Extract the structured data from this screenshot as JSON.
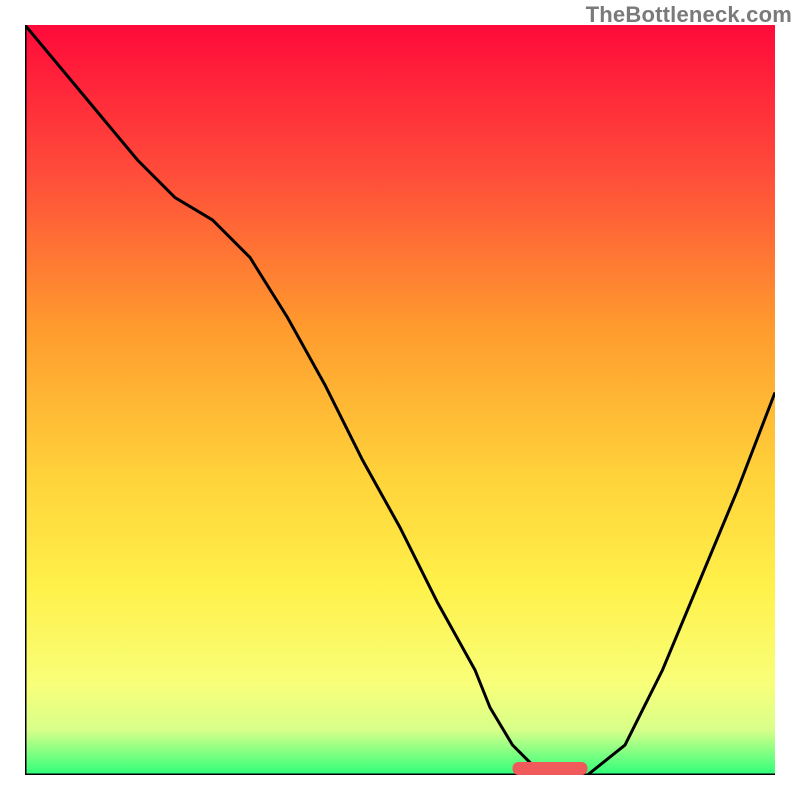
{
  "watermark": "TheBottleneck.com",
  "chart_data": {
    "type": "line",
    "title": "",
    "xlabel": "",
    "ylabel": "",
    "xlim": [
      0,
      100
    ],
    "ylim": [
      0,
      100
    ],
    "x": [
      0,
      5,
      10,
      15,
      20,
      25,
      30,
      35,
      40,
      45,
      50,
      55,
      60,
      62,
      65,
      68,
      70,
      75,
      80,
      85,
      90,
      95,
      100
    ],
    "values": [
      100,
      94,
      88,
      82,
      77,
      74,
      69,
      61,
      52,
      42,
      33,
      23,
      14,
      9,
      4,
      1,
      0,
      0,
      4,
      14,
      26,
      38,
      51
    ],
    "marker": {
      "x_start": 65,
      "x_end": 75,
      "y": 0.8
    }
  },
  "gradient": {
    "stops": [
      {
        "offset": 0,
        "color": "#ff0a3a"
      },
      {
        "offset": 20,
        "color": "#ff4d3a"
      },
      {
        "offset": 40,
        "color": "#ff9a2e"
      },
      {
        "offset": 60,
        "color": "#ffd23a"
      },
      {
        "offset": 75,
        "color": "#fff14a"
      },
      {
        "offset": 88,
        "color": "#f8ff7a"
      },
      {
        "offset": 94,
        "color": "#d8ff8a"
      },
      {
        "offset": 100,
        "color": "#2dff7a"
      }
    ]
  }
}
